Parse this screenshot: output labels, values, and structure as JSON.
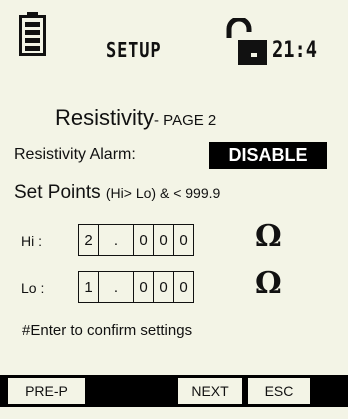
{
  "status": {
    "title": "SETUP",
    "time": "21:4"
  },
  "page": {
    "title": "Resistivity",
    "subtitle": "- PAGE 2"
  },
  "alarm": {
    "label": "Resistivity Alarm:",
    "value": "DISABLE"
  },
  "setpoints": {
    "label": "Set Points",
    "range": "(Hi> Lo) & < 999.9",
    "hi": {
      "label": "Hi :",
      "digits": [
        "2",
        ".",
        "0",
        "0",
        "0"
      ],
      "unit": "Ω"
    },
    "lo": {
      "label": "Lo :",
      "digits": [
        "1",
        ".",
        "0",
        "0",
        "0"
      ],
      "unit": "Ω"
    }
  },
  "hint": "#Enter to confirm settings",
  "softkeys": {
    "prev": "PRE-P",
    "next": "NEXT",
    "esc": "ESC"
  },
  "icons": {
    "battery": "battery-icon",
    "lock": "unlocked-lock-icon"
  }
}
